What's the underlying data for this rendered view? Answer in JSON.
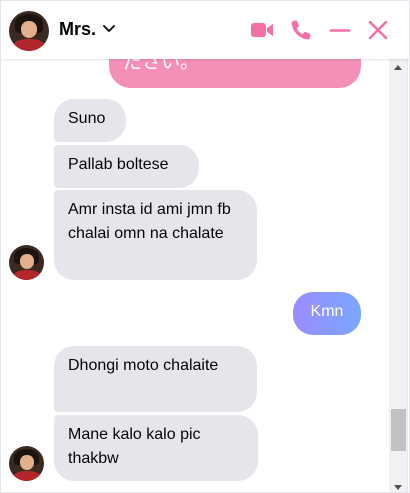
{
  "header": {
    "contact_name": "Mrs.",
    "icons": [
      "avatar",
      "chevron-down-icon",
      "video-call-icon",
      "phone-icon",
      "minimize-icon",
      "close-icon"
    ],
    "accent_color": "#f46fa6"
  },
  "messages": [
    {
      "sender": "me",
      "text": "ださい。"
    },
    {
      "sender": "contact",
      "text": "Suno"
    },
    {
      "sender": "contact",
      "text": "Pallab boltese"
    },
    {
      "sender": "contact",
      "text": "Amr insta id ami jmn fb chalai omn na chalate"
    },
    {
      "sender": "me",
      "text": "Kmn"
    },
    {
      "sender": "contact",
      "text": "Dhongi moto chalaite"
    },
    {
      "sender": "contact",
      "text": "Mane kalo kalo pic thakbw"
    }
  ],
  "colors": {
    "incoming_bubble": "#e4e6eb",
    "outgoing_pink": "#f48fb8",
    "outgoing_blue_start": "#9b8cff",
    "outgoing_blue_end": "#7aa7ff"
  }
}
